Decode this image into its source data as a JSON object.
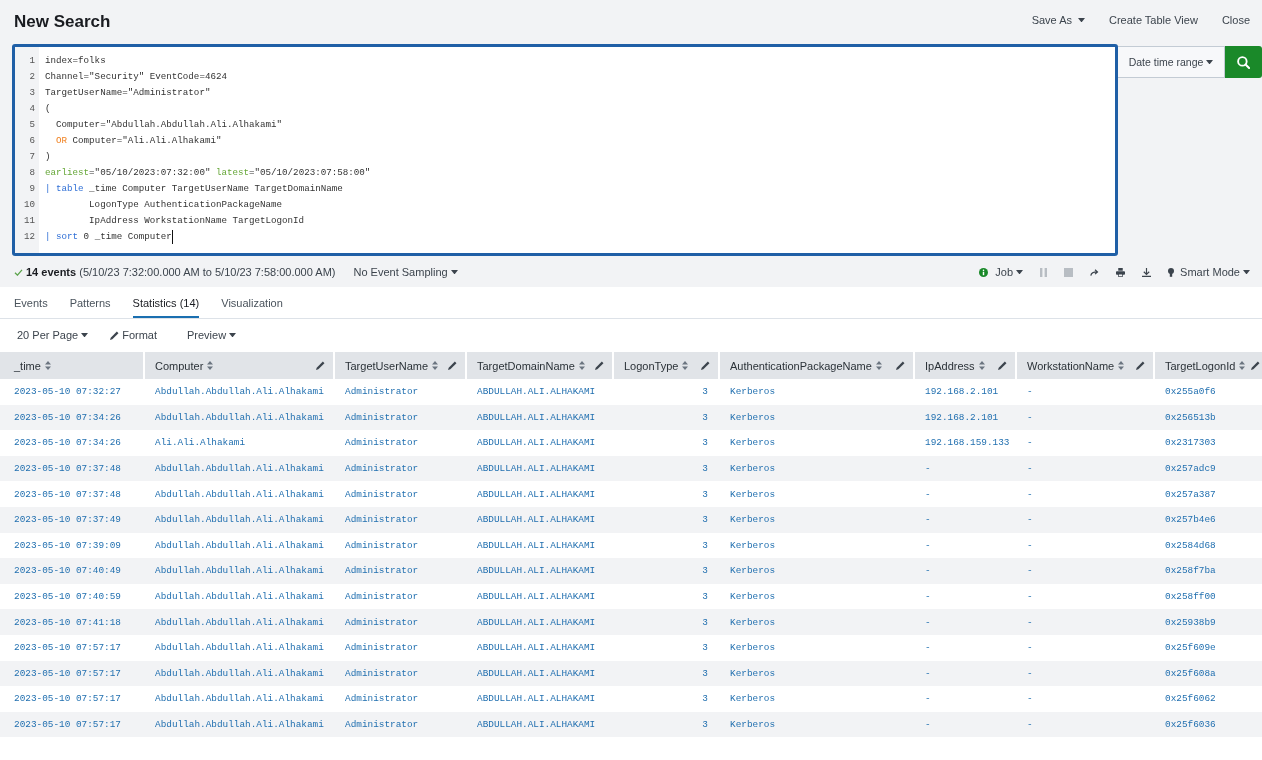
{
  "header": {
    "title": "New Search",
    "actions": [
      {
        "label": "Save As",
        "dropdown": true
      },
      {
        "label": "Create Table View",
        "dropdown": false
      },
      {
        "label": "Close",
        "dropdown": false
      }
    ]
  },
  "search": {
    "lines": [
      {
        "number": "1",
        "cursor": false,
        "tokens": [
          {
            "text": "index=folks",
            "kind": "plain"
          }
        ]
      },
      {
        "number": "2",
        "cursor": false,
        "tokens": [
          {
            "text": "Channel=\"Security\" EventCode=4624",
            "kind": "plain"
          }
        ]
      },
      {
        "number": "3",
        "cursor": false,
        "tokens": [
          {
            "text": "TargetUserName=\"Administrator\"",
            "kind": "plain"
          }
        ]
      },
      {
        "number": "4",
        "cursor": false,
        "tokens": [
          {
            "text": "(",
            "kind": "plain"
          }
        ]
      },
      {
        "number": "5",
        "cursor": false,
        "tokens": [
          {
            "text": "  Computer=\"Abdullah.Abdullah.Ali.Alhakami\"",
            "kind": "plain"
          }
        ]
      },
      {
        "number": "6",
        "cursor": false,
        "tokens": [
          {
            "text": "  OR",
            "kind": "keyword"
          },
          {
            "text": " Computer=\"Ali.Ali.Alhakami\"",
            "kind": "plain"
          }
        ]
      },
      {
        "number": "7",
        "cursor": false,
        "tokens": [
          {
            "text": ")",
            "kind": "plain"
          }
        ]
      },
      {
        "number": "8",
        "cursor": false,
        "tokens": [
          {
            "text": "earliest",
            "kind": "modifier"
          },
          {
            "text": "=\"05/10/2023:07:32:00\" ",
            "kind": "plain"
          },
          {
            "text": "latest",
            "kind": "modifier"
          },
          {
            "text": "=\"05/10/2023:07:58:00\"",
            "kind": "plain"
          }
        ]
      },
      {
        "number": "9",
        "cursor": false,
        "tokens": [
          {
            "text": "| table",
            "kind": "command"
          },
          {
            "text": " _time Computer TargetUserName TargetDomainName",
            "kind": "plain"
          }
        ]
      },
      {
        "number": "10",
        "cursor": false,
        "tokens": [
          {
            "text": "        LogonType AuthenticationPackageName",
            "kind": "plain"
          }
        ]
      },
      {
        "number": "11",
        "cursor": false,
        "tokens": [
          {
            "text": "        IpAddress WorkstationName TargetLogonId",
            "kind": "plain"
          }
        ]
      },
      {
        "number": "12",
        "cursor": true,
        "tokens": [
          {
            "text": "| sort",
            "kind": "command"
          },
          {
            "text": " 0 _time Computer",
            "kind": "plain"
          }
        ]
      }
    ],
    "time_range": "Date time range"
  },
  "status": {
    "summary": "**14 events** (5/10/23 7:32:00.000 AM to 5/10/23 7:58:00.000 AM)",
    "sampling": "No Event Sampling",
    "job": "Job",
    "job_actions": [
      {
        "kind": "pause",
        "disabled": true
      },
      {
        "kind": "stop",
        "disabled": true
      },
      {
        "kind": "share",
        "disabled": false
      },
      {
        "kind": "print",
        "disabled": false
      },
      {
        "kind": "export",
        "disabled": false
      }
    ],
    "mode": "Smart Mode"
  },
  "tabs": [
    {
      "label": "Events",
      "selected": false
    },
    {
      "label": "Patterns",
      "selected": false
    },
    {
      "label": "Statistics (14)",
      "selected": true
    },
    {
      "label": "Visualization",
      "selected": false
    }
  ],
  "table_toolbar": {
    "per_page": "20 Per Page",
    "format": "Format",
    "preview": "Preview"
  },
  "table": {
    "columns": [
      {
        "label": "_time",
        "kind": "text",
        "editable": false
      },
      {
        "label": "Computer",
        "kind": "text",
        "editable": true
      },
      {
        "label": "TargetUserName",
        "kind": "text",
        "editable": true
      },
      {
        "label": "TargetDomainName",
        "kind": "text",
        "editable": true
      },
      {
        "label": "LogonType",
        "kind": "number",
        "editable": true
      },
      {
        "label": "AuthenticationPackageName",
        "kind": "text",
        "editable": true
      },
      {
        "label": "IpAddress",
        "kind": "text",
        "editable": true
      },
      {
        "label": "WorkstationName",
        "kind": "text",
        "editable": true
      },
      {
        "label": "TargetLogonId",
        "kind": "text",
        "editable": true
      }
    ],
    "rows": [
      [
        "2023-05-10 07:32:27",
        "Abdullah.Abdullah.Ali.Alhakami",
        "Administrator",
        "ABDULLAH.ALI.ALHAKAMI",
        "3",
        "Kerberos",
        "192.168.2.101",
        "-",
        "0x255a0f6"
      ],
      [
        "2023-05-10 07:34:26",
        "Abdullah.Abdullah.Ali.Alhakami",
        "Administrator",
        "ABDULLAH.ALI.ALHAKAMI",
        "3",
        "Kerberos",
        "192.168.2.101",
        "-",
        "0x256513b"
      ],
      [
        "2023-05-10 07:34:26",
        "Ali.Ali.Alhakami",
        "Administrator",
        "ABDULLAH.ALI.ALHAKAMI",
        "3",
        "Kerberos",
        "192.168.159.133",
        "-",
        "0x2317303"
      ],
      [
        "2023-05-10 07:37:48",
        "Abdullah.Abdullah.Ali.Alhakami",
        "Administrator",
        "ABDULLAH.ALI.ALHAKAMI",
        "3",
        "Kerberos",
        "-",
        "-",
        "0x257adc9"
      ],
      [
        "2023-05-10 07:37:48",
        "Abdullah.Abdullah.Ali.Alhakami",
        "Administrator",
        "ABDULLAH.ALI.ALHAKAMI",
        "3",
        "Kerberos",
        "-",
        "-",
        "0x257a387"
      ],
      [
        "2023-05-10 07:37:49",
        "Abdullah.Abdullah.Ali.Alhakami",
        "Administrator",
        "ABDULLAH.ALI.ALHAKAMI",
        "3",
        "Kerberos",
        "-",
        "-",
        "0x257b4e6"
      ],
      [
        "2023-05-10 07:39:09",
        "Abdullah.Abdullah.Ali.Alhakami",
        "Administrator",
        "ABDULLAH.ALI.ALHAKAMI",
        "3",
        "Kerberos",
        "-",
        "-",
        "0x2584d68"
      ],
      [
        "2023-05-10 07:40:49",
        "Abdullah.Abdullah.Ali.Alhakami",
        "Administrator",
        "ABDULLAH.ALI.ALHAKAMI",
        "3",
        "Kerberos",
        "-",
        "-",
        "0x258f7ba"
      ],
      [
        "2023-05-10 07:40:59",
        "Abdullah.Abdullah.Ali.Alhakami",
        "Administrator",
        "ABDULLAH.ALI.ALHAKAMI",
        "3",
        "Kerberos",
        "-",
        "-",
        "0x258ff00"
      ],
      [
        "2023-05-10 07:41:18",
        "Abdullah.Abdullah.Ali.Alhakami",
        "Administrator",
        "ABDULLAH.ALI.ALHAKAMI",
        "3",
        "Kerberos",
        "-",
        "-",
        "0x25938b9"
      ],
      [
        "2023-05-10 07:57:17",
        "Abdullah.Abdullah.Ali.Alhakami",
        "Administrator",
        "ABDULLAH.ALI.ALHAKAMI",
        "3",
        "Kerberos",
        "-",
        "-",
        "0x25f609e"
      ],
      [
        "2023-05-10 07:57:17",
        "Abdullah.Abdullah.Ali.Alhakami",
        "Administrator",
        "ABDULLAH.ALI.ALHAKAMI",
        "3",
        "Kerberos",
        "-",
        "-",
        "0x25f608a"
      ],
      [
        "2023-05-10 07:57:17",
        "Abdullah.Abdullah.Ali.Alhakami",
        "Administrator",
        "ABDULLAH.ALI.ALHAKAMI",
        "3",
        "Kerberos",
        "-",
        "-",
        "0x25f6062"
      ],
      [
        "2023-05-10 07:57:17",
        "Abdullah.Abdullah.Ali.Alhakami",
        "Administrator",
        "ABDULLAH.ALI.ALHAKAMI",
        "3",
        "Kerberos",
        "-",
        "-",
        "0x25f6036"
      ]
    ]
  }
}
